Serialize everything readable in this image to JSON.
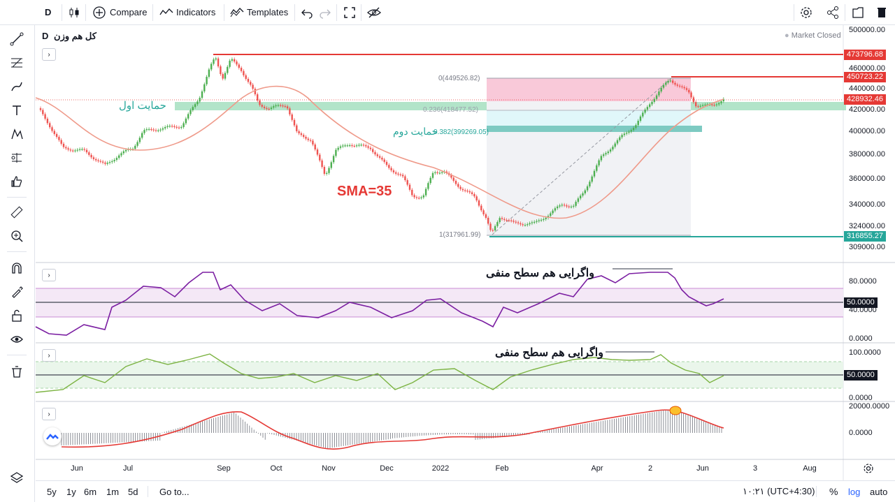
{
  "toolbar": {
    "interval": "D",
    "compare_label": "Compare",
    "indicators_label": "Indicators",
    "templates_label": "Templates"
  },
  "chart": {
    "symbol_title": "کل هم وزن",
    "interval_label": "D",
    "market_status": "Market Closed",
    "annotations": {
      "support1": "حمایت اول",
      "support2": "حمایت دوم",
      "sma_label": "SMA=35",
      "divergence_rsi": "واگرایی هم سطح منفی",
      "divergence_stoch": "واگرایی هم سطح منفی"
    },
    "fib_labels": [
      "0(449526.82)",
      "0.236(418477.52)",
      "0.382(399269.05)",
      "1(317961.99)"
    ],
    "price_axis": [
      "500000.00",
      "480000.00",
      "460000.00",
      "440000.00",
      "420000.00",
      "400000.00",
      "380000.00",
      "360000.00",
      "340000.00",
      "324000.00",
      "309000.00"
    ],
    "price_tags": {
      "resistance": "473796.68",
      "top": "450723.22",
      "last": "428932.46",
      "support": "316855.27"
    },
    "colors": {
      "red": "#e53935",
      "green": "#26a69a",
      "dark": "#131722",
      "up_candle": "#4caf50",
      "down_candle": "#ef5350",
      "sma": "#ef9a8a",
      "rsi": "#7b1fa2",
      "stoch": "#7cb342"
    }
  },
  "rsi_pane": {
    "axis": [
      "80.0000",
      "40.0000",
      "0.0000"
    ],
    "value_tag": "50.0000"
  },
  "stoch_pane": {
    "axis": [
      "100.0000",
      "0.0000"
    ],
    "value_tag": "50.0000"
  },
  "macd_pane": {
    "axis": [
      "20000.0000",
      "0.0000"
    ]
  },
  "time_axis": [
    "Jun",
    "Jul",
    "Sep",
    "Oct",
    "Nov",
    "Dec",
    "2022",
    "Feb",
    "Apr",
    "2",
    "Jun",
    "3",
    "Aug"
  ],
  "bottombar": {
    "ranges": [
      "5y",
      "1y",
      "6m",
      "1m",
      "5d"
    ],
    "goto_label": "Go to...",
    "clock": "۱۰:۲۱ (UTC+4:30)",
    "percent_label": "%",
    "log_label": "log",
    "auto_label": "auto"
  }
}
